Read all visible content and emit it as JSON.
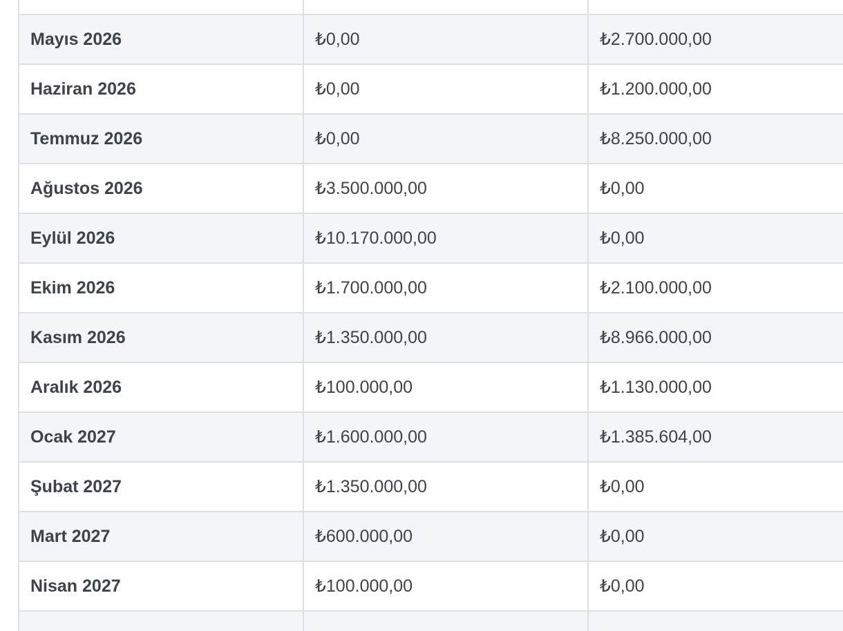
{
  "colors": {
    "row_shaded": "#f3f5f9",
    "row_plain": "#ffffff",
    "border": "#dcdfe3",
    "text": "#3d4348"
  },
  "rows": [
    {
      "month": "",
      "col2": "",
      "col3": ""
    },
    {
      "month": "Mayıs 2026",
      "col2": "₺0,00",
      "col3": "₺2.700.000,00"
    },
    {
      "month": "Haziran 2026",
      "col2": "₺0,00",
      "col3": "₺1.200.000,00"
    },
    {
      "month": "Temmuz 2026",
      "col2": "₺0,00",
      "col3": "₺8.250.000,00"
    },
    {
      "month": "Ağustos 2026",
      "col2": "₺3.500.000,00",
      "col3": "₺0,00"
    },
    {
      "month": "Eylül 2026",
      "col2": "₺10.170.000,00",
      "col3": "₺0,00"
    },
    {
      "month": "Ekim 2026",
      "col2": "₺1.700.000,00",
      "col3": "₺2.100.000,00"
    },
    {
      "month": "Kasım 2026",
      "col2": "₺1.350.000,00",
      "col3": "₺8.966.000,00"
    },
    {
      "month": "Aralık 2026",
      "col2": "₺100.000,00",
      "col3": "₺1.130.000,00"
    },
    {
      "month": "Ocak 2027",
      "col2": "₺1.600.000,00",
      "col3": "₺1.385.604,00"
    },
    {
      "month": "Şubat 2027",
      "col2": "₺1.350.000,00",
      "col3": "₺0,00"
    },
    {
      "month": "Mart 2027",
      "col2": "₺600.000,00",
      "col3": "₺0,00"
    },
    {
      "month": "Nisan 2027",
      "col2": "₺100.000,00",
      "col3": "₺0,00"
    },
    {
      "month": "",
      "col2": "",
      "col3": ""
    }
  ]
}
